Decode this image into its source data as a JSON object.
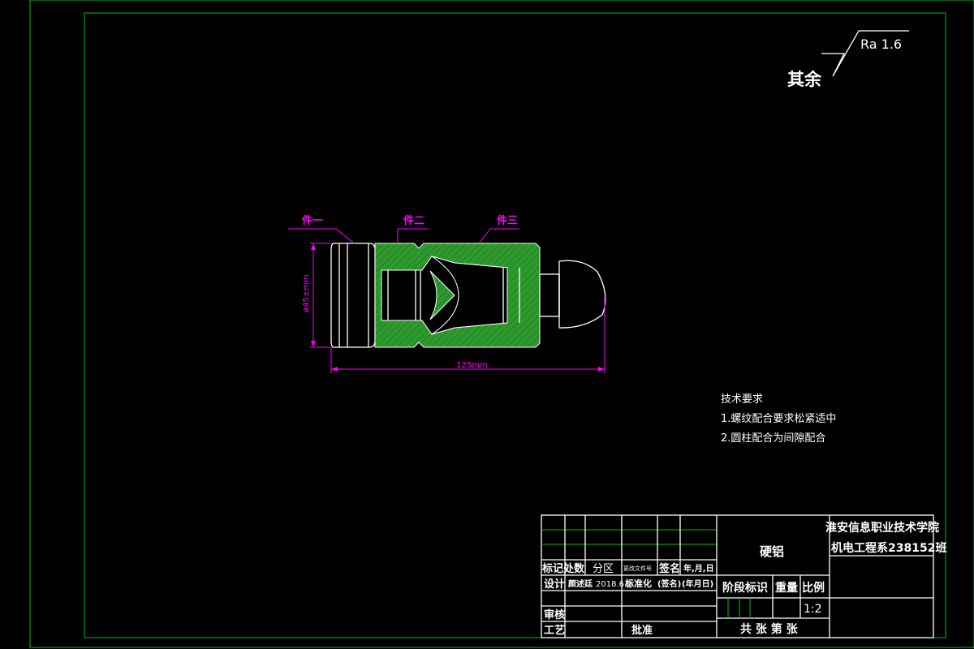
{
  "surface_finish": {
    "prefix": "其余",
    "value": "Ra 1.6"
  },
  "part_labels": [
    "件一",
    "件二",
    "件三"
  ],
  "dimensions": {
    "diameter": "ø45±mm",
    "length": "125mm"
  },
  "tech_requirements": {
    "title": "技术要求",
    "items": [
      "1.螺纹配合要求松紧适中",
      "2.圆柱配合为间隙配合"
    ]
  },
  "title_block": {
    "part_name": "硬铝",
    "school": "淮安信息职业技术学院",
    "department": "机电工程系238152班",
    "headers": [
      "标记",
      "处数",
      "分区",
      "更改文件号",
      "签名",
      "年,月,日"
    ],
    "design_label": "设计",
    "designer": "颜述廷",
    "date": "2018.6.2",
    "standardize": "标准化",
    "sign_placeholder": "(签名)",
    "date_placeholder": "(年月日)",
    "stage_label": "阶段标识",
    "weight_label": "重量",
    "scale_label": "比例",
    "scale_value": "1:2",
    "review_label": "审核",
    "process_label": "工艺",
    "approve_label": "批准",
    "sheets": "共 张 第 张"
  },
  "colors": {
    "border": "#00c000",
    "part_fill": "#2e9a2e",
    "dimension": "#ff00ff",
    "line": "#ffffff"
  }
}
